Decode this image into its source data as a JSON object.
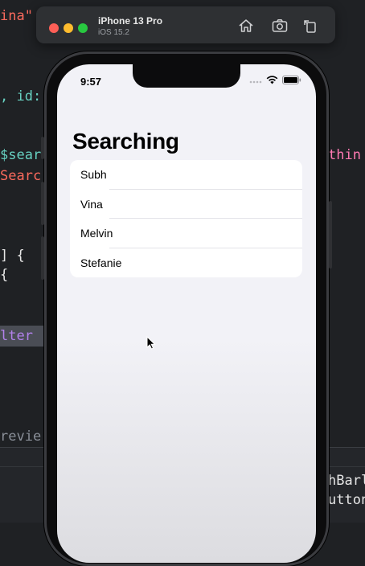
{
  "editor": {
    "lines": [
      {
        "text": "ina\"",
        "color": "red"
      },
      {
        "text": ", id:",
        "color": "teal"
      },
      {
        "text": "$sear",
        "color": "teal"
      },
      {
        "text": "Searc",
        "color": "red"
      },
      {
        "text": "thin",
        "color": "pink"
      },
      {
        "text": "] {",
        "color": "white"
      },
      {
        "text": "{",
        "color": "white"
      },
      {
        "text": "lter",
        "color": "purple"
      },
      {
        "text": "revie",
        "color": "gray"
      },
      {
        "text": "hBarl",
        "color": "white"
      },
      {
        "text": "utton",
        "color": "white"
      }
    ]
  },
  "simulator": {
    "device_name": "iPhone 13 Pro",
    "os_version": "iOS 15.2",
    "toolbar_icons": [
      "home-icon",
      "screenshot-icon",
      "rotate-icon"
    ]
  },
  "status_bar": {
    "time": "9:57",
    "icons": [
      "cellular-dots-icon",
      "wifi-icon",
      "battery-icon"
    ]
  },
  "screen": {
    "title": "Searching",
    "names": [
      "Subh",
      "Vina",
      "Melvin",
      "Stefanie"
    ]
  },
  "colors": {
    "accent_pink": "#ff7ab2",
    "accent_teal": "#67d2c2",
    "string_red": "#fc6a5d",
    "traffic_red": "#fe5f57",
    "traffic_yellow": "#febc2e",
    "traffic_green": "#28c840"
  }
}
